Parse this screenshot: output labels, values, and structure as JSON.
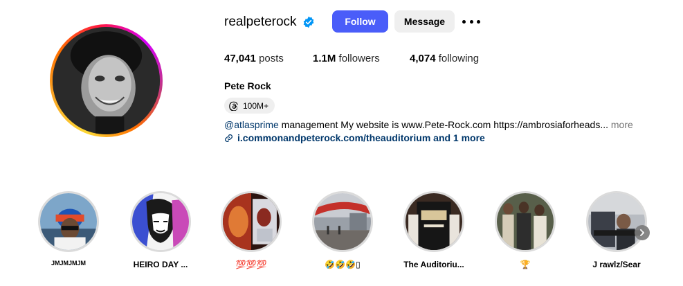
{
  "profile": {
    "username": "realpeterock",
    "verified_icon": "verified-badge-icon",
    "follow_label": "Follow",
    "message_label": "Message",
    "options_icon": "more-options-icon",
    "full_name": "Pete Rock",
    "threads_badge": "100M+",
    "bio_mention": "@atlasprime",
    "bio_text": " management My website is www.Pete-Rock.com https://ambrosiaforheads...",
    "bio_more": " more",
    "link_text": "i.commonandpeterock.com/theauditorium and 1 more"
  },
  "stats": {
    "posts_value": "47,041",
    "posts_label": "posts",
    "followers_value": "1.1M",
    "followers_label": "followers",
    "following_value": "4,074",
    "following_label": "following"
  },
  "highlights": [
    {
      "label": "JMJMJMJM"
    },
    {
      "label": "HEIRO DAY ..."
    },
    {
      "label": "💯💯💯"
    },
    {
      "label": "🤣🤣🤣▯"
    },
    {
      "label": "The Auditoriu..."
    },
    {
      "label": "🏆"
    },
    {
      "label": "J rawlz/Sear"
    }
  ],
  "colors": {
    "follow_button": "#4a5df9",
    "message_button": "#efefef",
    "link": "#00376b",
    "verified": "#0095f6"
  }
}
